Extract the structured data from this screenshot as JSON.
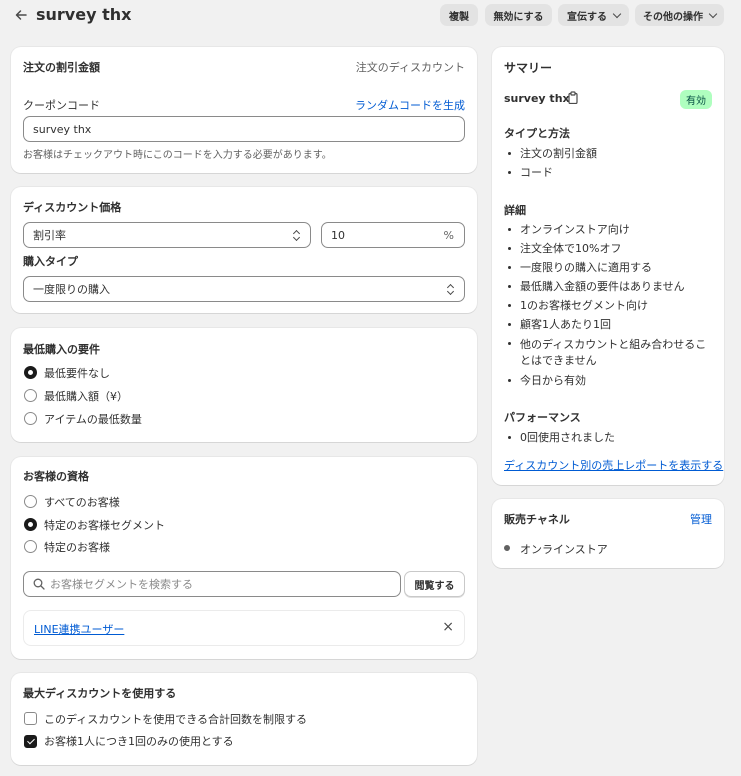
{
  "header": {
    "title": "survey thx",
    "actions": [
      "複製",
      "無効にする",
      "宣伝する",
      "その他の操作"
    ]
  },
  "amount_card": {
    "title": "注文の割引金額",
    "subtitle": "注文のディスカウント",
    "code_label": "クーポンコード",
    "generate_link": "ランダムコードを生成",
    "code_value": "survey thx",
    "help": "お客様はチェックアウト時にこのコードを入力する必要があります。"
  },
  "value_card": {
    "title": "ディスカウント価格",
    "type_value": "割引率",
    "amount_value": "10",
    "amount_suffix": "%",
    "purchase_type_label": "購入タイプ",
    "purchase_type_value": "一度限りの購入"
  },
  "min_req_card": {
    "title": "最低購入の要件",
    "options": [
      "最低要件なし",
      "最低購入額（¥）",
      "アイテムの最低数量"
    ],
    "selected": 0
  },
  "eligibility_card": {
    "title": "お客様の資格",
    "options": [
      "すべてのお客様",
      "特定のお客様セグメント",
      "特定のお客様"
    ],
    "selected": 1,
    "search_placeholder": "お客様セグメントを検索する",
    "browse_button": "閲覧する",
    "segment_name": "LINE連携ユーザー",
    "remove_icon": "×"
  },
  "max_uses_card": {
    "title": "最大ディスカウントを使用する",
    "options": [
      "このディスカウントを使用できる合計回数を制限する",
      "お客様1人につき1回のみの使用とする"
    ],
    "checked": [
      false,
      true
    ]
  },
  "summary": {
    "title": "サマリー",
    "code": "survey thx",
    "status": "有効",
    "type_heading": "タイプと方法",
    "type_items": [
      "注文の割引金額",
      "コード"
    ],
    "details_heading": "詳細",
    "details_items": [
      "オンラインストア向け",
      "注文全体で10%オフ",
      "一度限りの購入に適用する",
      "最低購入金額の要件はありません",
      "1のお客様セグメント向け",
      "顧客1人あたり1回",
      "他のディスカウントと組み合わせることはできません",
      "今日から有効"
    ],
    "performance_heading": "パフォーマンス",
    "performance_items": [
      "0回使用されました"
    ],
    "report_link": "ディスカウント別の売上レポートを表示する"
  },
  "sales_channel": {
    "title": "販売チャネル",
    "manage_link": "管理",
    "channel": "オンラインストア"
  },
  "colors": {
    "accent": "#005bd3",
    "badge_bg": "#affebf",
    "badge_text": "#014b40",
    "background": "#f1f1f1"
  }
}
